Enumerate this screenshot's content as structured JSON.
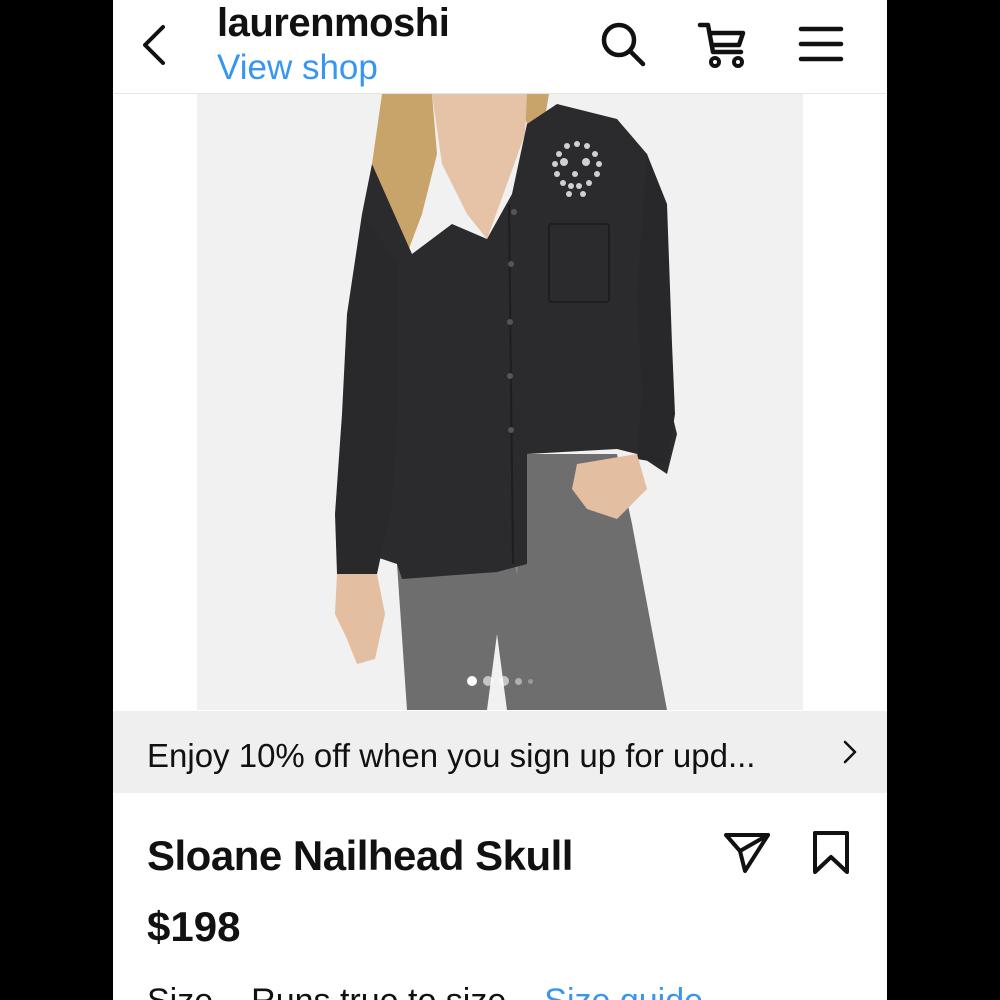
{
  "header": {
    "shop_name": "laurenmoshi",
    "view_shop_label": "View shop",
    "icons": [
      "back-chevron-icon",
      "search-icon",
      "cart-icon",
      "menu-icon"
    ]
  },
  "carousel": {
    "total_dots": 5,
    "active_index": 0
  },
  "promo": {
    "text": "Enjoy 10% off when you sign up for upd..."
  },
  "product": {
    "title": "Sloane Nailhead Skull",
    "price": "$198",
    "size_label": "Size",
    "size_value": "Runs true to size",
    "size_guide_label": "Size guide"
  },
  "colors": {
    "accent": "#3797f0",
    "text": "#111111",
    "promo_bg": "#efefef",
    "photo_bg": "#f1f1f1"
  }
}
